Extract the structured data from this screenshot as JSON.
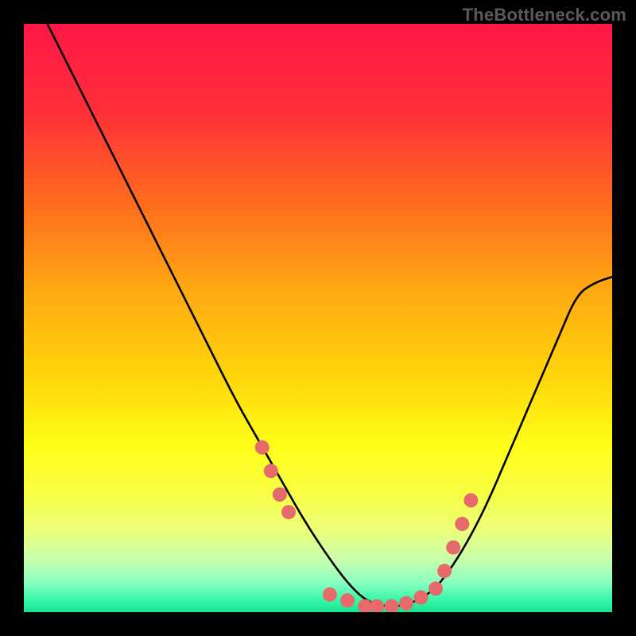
{
  "attribution": "TheBottleneck.com",
  "chart_data": {
    "type": "line",
    "title": "",
    "xlabel": "",
    "ylabel": "",
    "xlim": [
      0,
      100
    ],
    "ylim": [
      0,
      100
    ],
    "grid": false,
    "legend": false,
    "gradient_stops": [
      {
        "pos": 0.0,
        "color": "#ff1747"
      },
      {
        "pos": 0.15,
        "color": "#ff2f3a"
      },
      {
        "pos": 0.3,
        "color": "#ff6a1f"
      },
      {
        "pos": 0.45,
        "color": "#ffa813"
      },
      {
        "pos": 0.6,
        "color": "#ffd60a"
      },
      {
        "pos": 0.72,
        "color": "#ffff1a"
      },
      {
        "pos": 0.8,
        "color": "#f7ff45"
      },
      {
        "pos": 0.86,
        "color": "#ecff7a"
      },
      {
        "pos": 0.91,
        "color": "#c9ffab"
      },
      {
        "pos": 0.95,
        "color": "#8affc2"
      },
      {
        "pos": 0.98,
        "color": "#33f7a8"
      },
      {
        "pos": 1.0,
        "color": "#18e28e"
      }
    ],
    "series": [
      {
        "name": "bottleneck-curve",
        "color": "#000000",
        "x": [
          4,
          8,
          12,
          16,
          20,
          24,
          28,
          32,
          36,
          40,
          44,
          48,
          52,
          55,
          58,
          61,
          64,
          67,
          70,
          73,
          76,
          79,
          82,
          85,
          88,
          91,
          94,
          97,
          100
        ],
        "y": [
          100,
          92,
          84,
          76,
          68,
          60,
          52,
          44,
          36,
          29,
          22,
          15,
          9,
          5,
          2,
          1,
          1,
          2,
          4,
          8,
          13,
          19,
          26,
          33,
          40,
          47,
          54,
          56,
          57
        ]
      }
    ],
    "markers": {
      "name": "highlight-dots",
      "color": "#e66a6a",
      "radius": 9,
      "x": [
        40.5,
        42,
        43.5,
        45,
        52,
        55,
        58,
        60,
        62.5,
        65,
        67.5,
        70,
        71.5,
        73,
        74.5,
        76
      ],
      "y": [
        28,
        24,
        20,
        17,
        3,
        2,
        1,
        1,
        1,
        1.5,
        2.5,
        4,
        7,
        11,
        15,
        19
      ]
    }
  }
}
